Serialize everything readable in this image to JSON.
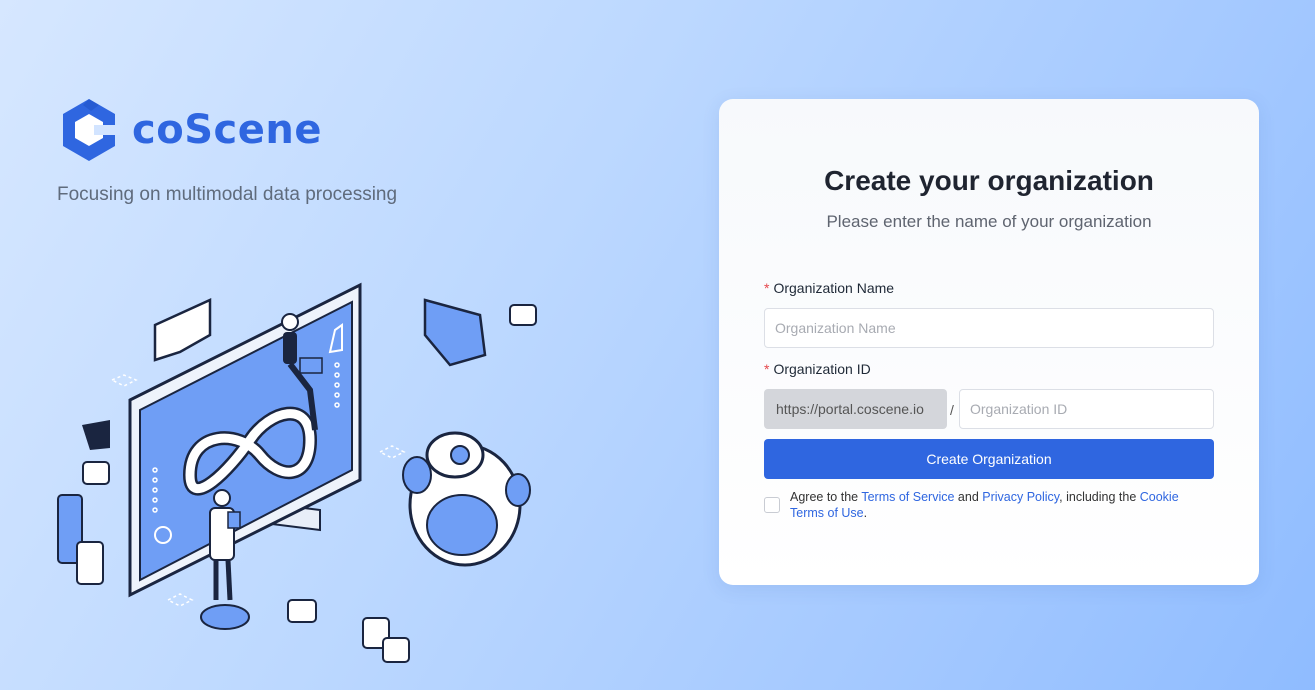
{
  "brand": {
    "name": "coScene",
    "tagline": "Focusing on multimodal data processing",
    "color": "#2f66e0"
  },
  "form": {
    "title": "Create your organization",
    "subtitle": "Please enter the name of your organization",
    "org_name": {
      "label": "Organization Name",
      "placeholder": "Organization Name",
      "value": ""
    },
    "org_id": {
      "label": "Organization ID",
      "prefix": "https://portal.coscene.io",
      "separator": "/",
      "placeholder": "Organization ID",
      "value": ""
    },
    "submit_label": "Create Organization",
    "agreement": {
      "checked": false,
      "text_before": "Agree to the ",
      "terms_of_service": "Terms of Service",
      "and": " and ",
      "privacy_policy": "Privacy Policy",
      "text_mid": ", including the ",
      "cookie_terms": "Cookie Terms of Use",
      "text_after": "."
    }
  },
  "colors": {
    "accent": "#2f66e0",
    "required": "#e5484d"
  }
}
